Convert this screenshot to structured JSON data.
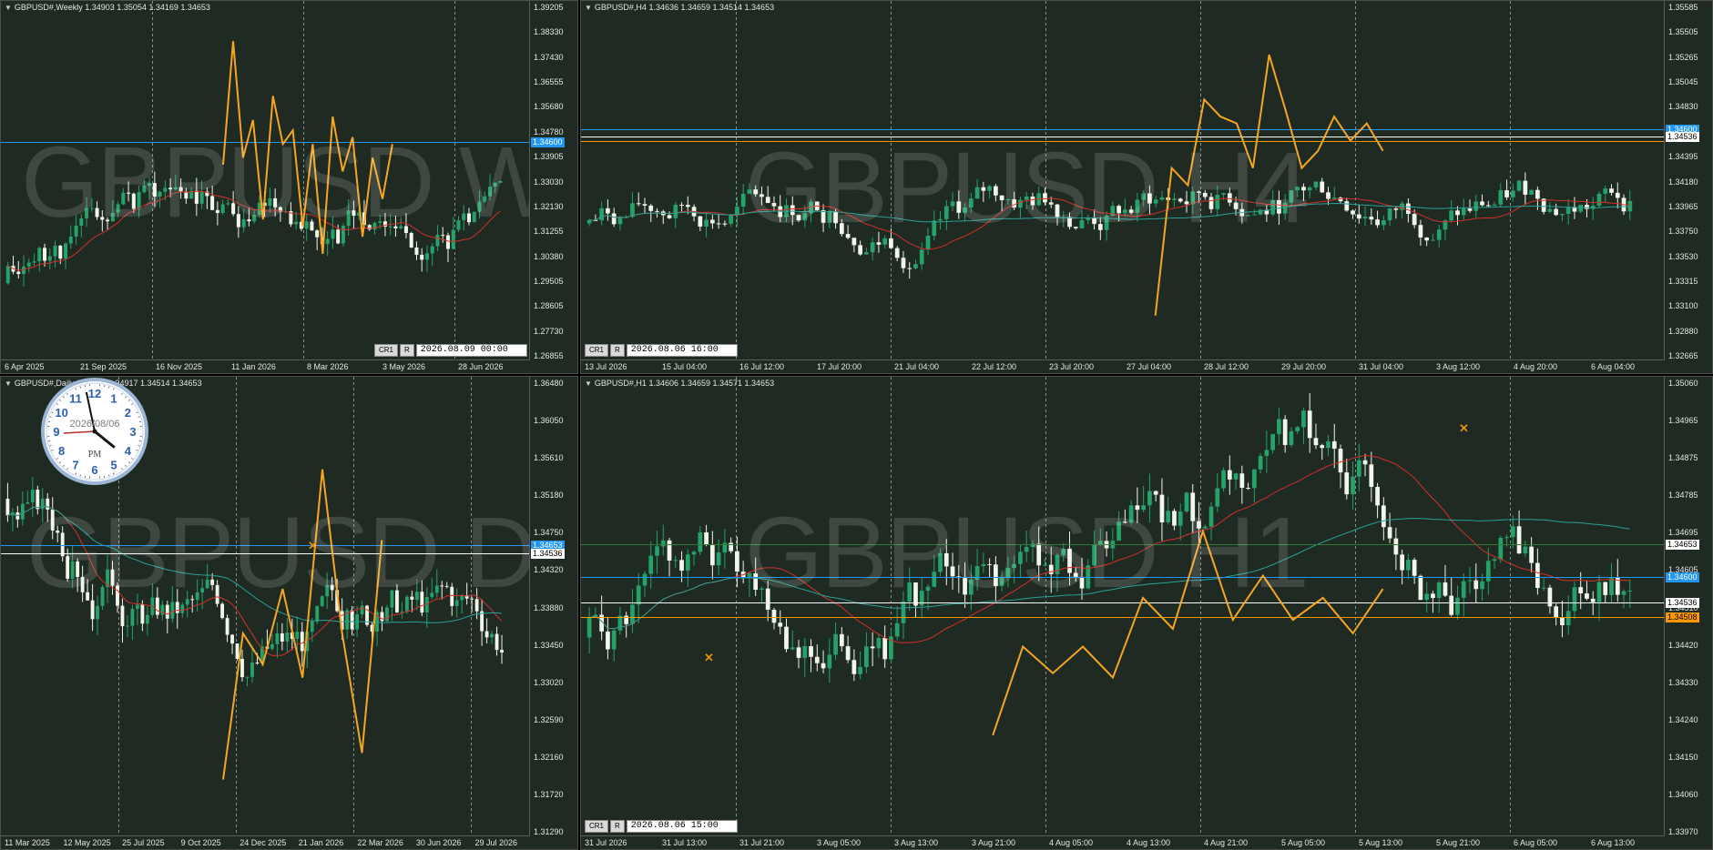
{
  "colors": {
    "bg": "#1e2a22",
    "up": "#26a269",
    "down": "#f2f5ea",
    "zigzag": "#f5a623",
    "ma_red": "#d2302a",
    "ma_green": "#2aa198",
    "blue": "#2196f3",
    "orange": "#ff9800",
    "white": "#ffffff"
  },
  "panes": [
    {
      "id": "w1",
      "title": "GBPUSD#,Weekly  1.34903 1.35054 1.34169 1.34653",
      "watermark": "GBPUSD W1",
      "yticks": [
        "1.39205",
        "1.38330",
        "1.37430",
        "1.36555",
        "1.35680",
        "1.34780",
        "1.33905",
        "1.33030",
        "1.32130",
        "1.31255",
        "1.30380",
        "1.29505",
        "1.28605",
        "1.27730",
        "1.26855"
      ],
      "xticks": [
        "6 Apr 2025",
        "21 Sep 2025",
        "16 Nov 2025",
        "11 Jan 2026",
        "8 Mar 2026",
        "3 May 2026",
        "28 Jun 2026"
      ],
      "price_tags": [
        {
          "text": "1.34600",
          "bg": "#2196f3",
          "fg": "#ffffff"
        }
      ],
      "buttons": [
        "CR1",
        "R"
      ],
      "date": "2026.08.09 00:00",
      "seed": 11,
      "n": 95,
      "ymin": 1.26855,
      "ymax": 1.39205,
      "start": 1.295,
      "vol": 0.006,
      "zig": [
        0.56,
        0.92,
        0.58,
        0.69,
        0.4,
        0.76,
        0.62,
        0.66,
        0.38,
        0.62,
        0.3,
        0.7,
        0.54,
        0.64,
        0.35,
        0.58,
        0.46,
        0.62
      ],
      "lines": [
        {
          "y": 1.346,
          "color": "#2196f3"
        }
      ],
      "ma": [
        {
          "color": "#d2302a",
          "p": 12
        }
      ]
    },
    {
      "id": "h4",
      "title": "GBPUSD#,H4  1.34636 1.34659 1.34514 1.34653",
      "watermark": "GBPUSD H4",
      "yticks": [
        "1.35585",
        "1.35505",
        "1.35265",
        "1.35045",
        "1.34830",
        "1.34615",
        "1.34395",
        "1.34180",
        "1.33965",
        "1.33750",
        "1.33530",
        "1.33315",
        "1.33100",
        "1.32880",
        "1.32665"
      ],
      "xticks": [
        "13 Jul 2026",
        "15 Jul 04:00",
        "16 Jul 12:00",
        "17 Jul 20:00",
        "21 Jul 04:00",
        "22 Jul 12:00",
        "23 Jul 20:00",
        "27 Jul 04:00",
        "28 Jul 12:00",
        "29 Jul 20:00",
        "31 Jul 04:00",
        "3 Aug 12:00",
        "4 Aug 20:00",
        "6 Aug 04:00"
      ],
      "price_tags": [
        {
          "text": "1.34600",
          "bg": "#2196f3",
          "fg": "#ffffff"
        },
        {
          "text": "1.34536",
          "bg": "#ffffff",
          "fg": "#000000"
        }
      ],
      "buttons": [
        "CR1",
        "R"
      ],
      "date": "2026.08.06 16:00",
      "seed": 7,
      "n": 170,
      "ymin": 1.32665,
      "ymax": 1.35585,
      "start": 1.338,
      "vol": 0.0012,
      "zig": [
        0.12,
        0.55,
        0.5,
        0.75,
        0.7,
        0.68,
        0.55,
        0.88,
        0.72,
        0.55,
        0.6,
        0.7,
        0.63,
        0.68,
        0.6
      ],
      "lines": [
        {
          "y": 1.346,
          "color": "#2196f3"
        },
        {
          "y": 1.34536,
          "color": "#ffffff"
        },
        {
          "y": 1.345,
          "color": "#ff9800"
        }
      ],
      "ma": [
        {
          "color": "#d2302a",
          "p": 15
        },
        {
          "color": "#2aa198",
          "p": 60
        }
      ]
    },
    {
      "id": "d1",
      "title": "GBPUSD#,Daily  1.34903 1.34917 1.34514 1.34653",
      "watermark": "GBPUSD D1",
      "yticks": [
        "1.36480",
        "1.36050",
        "1.35610",
        "1.35180",
        "1.34750",
        "1.34320",
        "1.33880",
        "1.33450",
        "1.33020",
        "1.32590",
        "1.32160",
        "1.31720",
        "1.31290"
      ],
      "xticks": [
        "11 Mar 2025",
        "12 May 2025",
        "25 Jul 2025",
        "9 Oct 2025",
        "24 Dec 2025",
        "21 Jan 2026",
        "22 Mar 2026",
        "30 Jun 2026",
        "29 Jul 2026"
      ],
      "price_tags": [
        {
          "text": "1.34653",
          "bg": "#2196f3",
          "fg": "#ffffff"
        },
        {
          "text": "1.34536",
          "bg": "#ffffff",
          "fg": "#000000"
        }
      ],
      "buttons": [],
      "date": "",
      "seed": 3,
      "n": 100,
      "ymin": 1.3129,
      "ymax": 1.3648,
      "start": 1.352,
      "vol": 0.0025,
      "zig": [
        0.12,
        0.45,
        0.38,
        0.55,
        0.35,
        0.82,
        0.45,
        0.18,
        0.66
      ],
      "lines": [
        {
          "y": 1.3466,
          "color": "#2196f3"
        },
        {
          "y": 1.3456,
          "color": "#ffffff"
        }
      ],
      "ma": [
        {
          "color": "#d2302a",
          "p": 10
        },
        {
          "color": "#2aa198",
          "p": 45
        }
      ]
    },
    {
      "id": "h1",
      "title": "GBPUSD#,H1  1.34606 1.34659 1.34571 1.34653",
      "watermark": "GBPUSD H1",
      "yticks": [
        "1.35060",
        "1.34965",
        "1.34875",
        "1.34785",
        "1.34695",
        "1.34605",
        "1.34510",
        "1.34420",
        "1.34330",
        "1.34240",
        "1.34150",
        "1.34060",
        "1.33970"
      ],
      "xticks": [
        "31 Jul 2026",
        "31 Jul 13:00",
        "31 Jul 21:00",
        "3 Aug 05:00",
        "3 Aug 13:00",
        "3 Aug 21:00",
        "4 Aug 05:00",
        "4 Aug 13:00",
        "4 Aug 21:00",
        "5 Aug 05:00",
        "5 Aug 13:00",
        "5 Aug 21:00",
        "6 Aug 05:00",
        "6 Aug 13:00"
      ],
      "price_tags": [
        {
          "text": "1.34653",
          "bg": "#ffffff",
          "fg": "#000000"
        },
        {
          "text": "1.34600",
          "bg": "#2196f3",
          "fg": "#ffffff"
        },
        {
          "text": "1.34536",
          "bg": "#ffffff",
          "fg": "#000000"
        },
        {
          "text": "1.34508",
          "bg": "#ff9800",
          "fg": "#000000"
        }
      ],
      "buttons": [
        "CR1",
        "R"
      ],
      "date": "2026.08.06 15:00",
      "seed": 5,
      "n": 170,
      "ymin": 1.3397,
      "ymax": 1.3506,
      "start": 1.3445,
      "vol": 0.0006,
      "zig": [
        0.22,
        0.42,
        0.36,
        0.42,
        0.35,
        0.53,
        0.46,
        0.68,
        0.48,
        0.58,
        0.48,
        0.53,
        0.45,
        0.55
      ],
      "lines": [
        {
          "y": 1.3468,
          "color": "#2e7d32"
        },
        {
          "y": 1.346,
          "color": "#2196f3"
        },
        {
          "y": 1.34536,
          "color": "#ffffff"
        },
        {
          "y": 1.345,
          "color": "#ff9800"
        }
      ],
      "ma": [
        {
          "color": "#d2302a",
          "p": 24
        },
        {
          "color": "#2aa198",
          "p": 80
        }
      ]
    }
  ],
  "clock": {
    "date": "2026/08/06",
    "ampm": "PM",
    "numbers": [
      "12",
      "1",
      "2",
      "3",
      "4",
      "5",
      "6",
      "7",
      "8",
      "9",
      "10",
      "11"
    ],
    "hour": 4.3,
    "minute": 58
  }
}
